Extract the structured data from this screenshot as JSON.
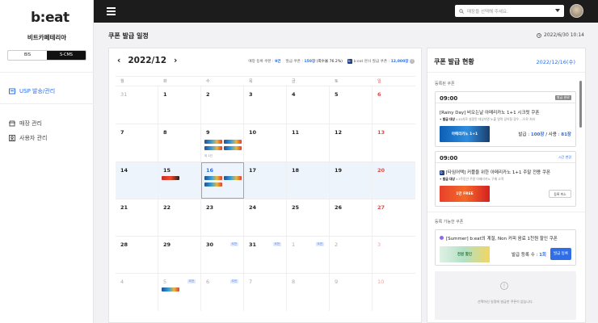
{
  "sidebar": {
    "logo": "b:eat",
    "store": "비트카페테리아",
    "toggle": [
      "BIS",
      "S-CMS"
    ],
    "nav": [
      {
        "label": "USP 발송/관리",
        "icon": "usp-icon"
      },
      {
        "label": "매장 관리",
        "icon": "store-icon"
      },
      {
        "label": "사용자 관리",
        "icon": "user-icon"
      }
    ]
  },
  "topbar": {
    "search_placeholder": "매장을 선택해 주세요."
  },
  "page": {
    "title": "쿠폰 발급 일정",
    "datetime": "2022/6/30 10:14"
  },
  "calendar": {
    "month": "2022/12",
    "stats": {
      "registered_label": "예정 등록 쿠폰 :",
      "registered_value": "9건",
      "issued_label": "발급 쿠폰 :",
      "issued_value": "150장",
      "usage": "(회수율 76.2%)",
      "hq_badge": "b:",
      "hq_label": "b:eat 본사 발급 쿠폰 :",
      "hq_value": "12,000장"
    },
    "weekdays": [
      "월",
      "화",
      "수",
      "목",
      "금",
      "토",
      "일"
    ],
    "weeks": [
      [
        "31",
        "1",
        "2",
        "3",
        "4",
        "5",
        "6"
      ],
      [
        "7",
        "8",
        "9",
        "10",
        "11",
        "12",
        "13"
      ],
      [
        "14",
        "15",
        "16",
        "17",
        "18",
        "19",
        "20"
      ],
      [
        "21",
        "22",
        "23",
        "24",
        "25",
        "26",
        "27"
      ],
      [
        "28",
        "29",
        "30",
        "31",
        "1",
        "2",
        "3"
      ],
      [
        "4",
        "5",
        "6",
        "7",
        "8",
        "9",
        "10"
      ]
    ],
    "more_label": "외 1건",
    "badge_label": "오전"
  },
  "right": {
    "title": "쿠폰 발급 현황",
    "date": "2022/12/16(수)",
    "registered_section": "등록된 쿠폰",
    "cards": [
      {
        "time": "09:00",
        "tag": "발급 완료",
        "title": "[Rainy Day] 비오는날 아메리카노 1+1 시크릿 쿠폰",
        "target_label": "• 발급 대상 :",
        "target_text": "40자로 설정된 대상자명 노출 영역 길어질 경우 ...으로 처리",
        "banner": "아메리카노 1+1",
        "issued_label": "발급 :",
        "issued_value": "100장",
        "used_label": "/ 사용 :",
        "used_value": "81장"
      },
      {
        "time": "09:00",
        "tag": "시간 변경",
        "title": "[타임어택] 커플을 위한 아메리카노 1+1 주말 전용 쿠폰",
        "target_label": "• 발급 대상 :",
        "target_text": "3주동안 주말 아메리카노 구매 고객",
        "banner": "1만 FREE",
        "cancel": "등록 취소"
      }
    ],
    "available_section": "등록 가능한 쿠폰",
    "available": {
      "title": "[Summer] b:eat의 계절, Non 커피 음료 1천원 할인 쿠폰",
      "banner": "천원 할인",
      "count_label": "발급 등록 수 :",
      "count_value": "1회",
      "button": "발급 등록"
    },
    "empty_text": "선택하신 일정에 발급한 쿠폰이 없습니다."
  }
}
